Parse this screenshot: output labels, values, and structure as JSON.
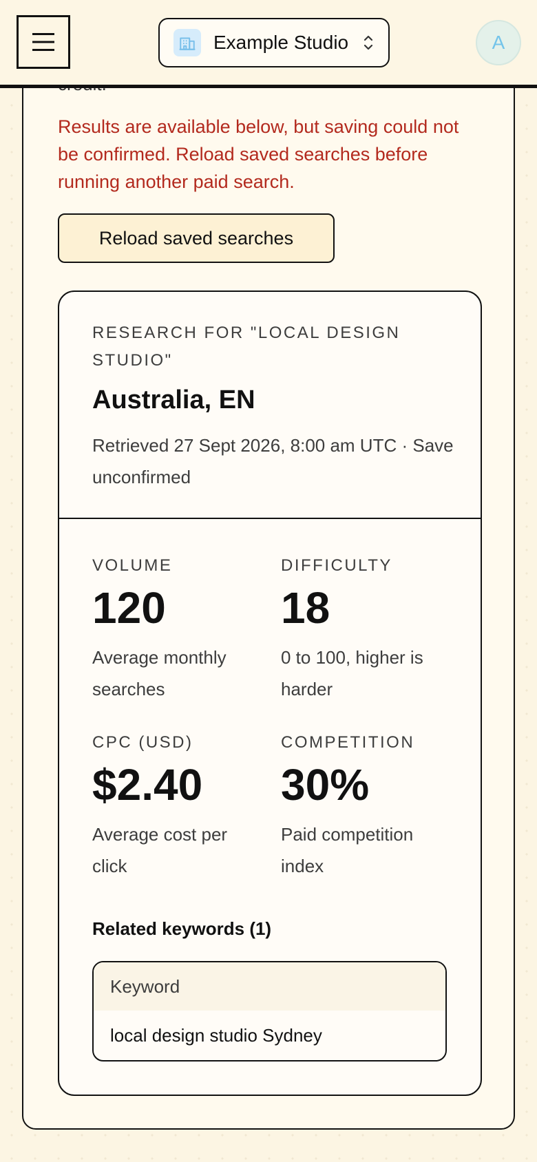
{
  "header": {
    "menu_icon": "hamburger-menu-icon",
    "org_icon": "building-icon",
    "org_name": "Example Studio",
    "org_selector_icon": "chevron-up-down-icon",
    "avatar_initial": "A",
    "colors": {
      "bar_background": "#fdf6e4",
      "org_icon_background": "#d6ecfb",
      "org_icon_color": "#78bfea",
      "avatar_background": "#e4f1ea",
      "avatar_text": "#73c4ea"
    }
  },
  "notice": {
    "clipped_text": "credit.",
    "error_message": "Results are available below, but saving could not be confirmed. Reload saved searches before running another paid search.",
    "reload_button_label": "Reload saved searches",
    "error_color": "#b32a1e"
  },
  "result": {
    "research_label": "Research for \"local design studio\"",
    "locale_title": "Australia, EN",
    "retrieved_text": "Retrieved 27 Sept 2026, 8:00 am UTC · Save unconfirmed",
    "metrics": {
      "volume": {
        "label": "Volume",
        "value": "120",
        "description": "Average monthly searches"
      },
      "difficulty": {
        "label": "Difficulty",
        "value": "18",
        "description": "0 to 100, higher is harder"
      },
      "cpc": {
        "label": "CPC (USD)",
        "value": "$2.40",
        "description": "Average cost per click"
      },
      "competition": {
        "label": "Competition",
        "value": "30%",
        "description": "Paid competition index"
      }
    },
    "related_heading": "Related keywords (1)",
    "table": {
      "column_header": "Keyword",
      "rows": [
        "local design studio Sydney"
      ]
    }
  },
  "theme": {
    "page_background": "#fcf5e3",
    "panel_background": "#fffaee",
    "card_background": "#fffcf7",
    "button_background": "#fdf1d4",
    "border_color": "#111111"
  }
}
